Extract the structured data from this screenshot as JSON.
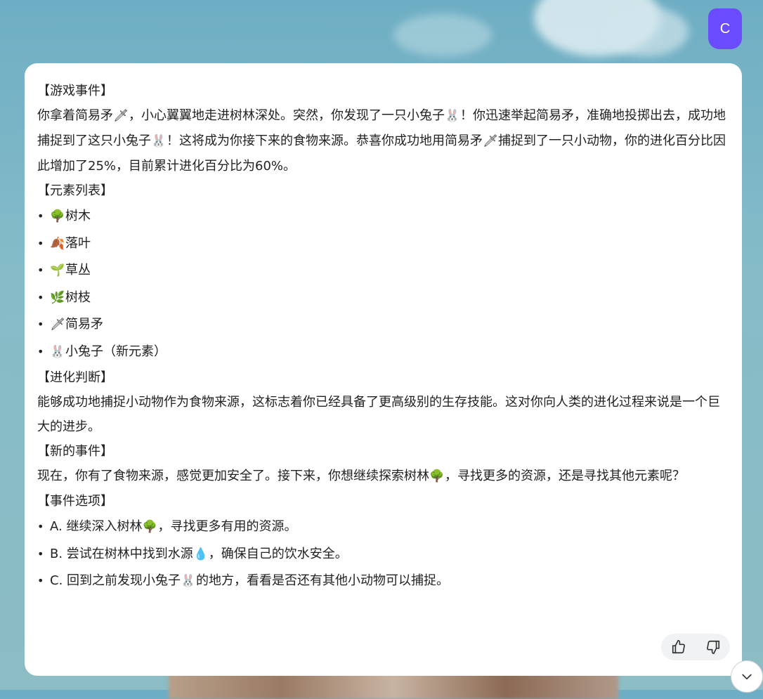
{
  "avatar": {
    "initial": "C"
  },
  "message": {
    "event_heading": "【游戏事件】",
    "event_text_parts": [
      "你拿着简易矛",
      "，小心翼翼地走进树林深处。突然，你发现了一只小兔子",
      "！你迅速举起简易矛，准确地投掷出去，成功地捕捉到了这只小兔子",
      "！这将成为你接下来的食物来源。恭喜你成功地用简易矛",
      "捕捉到了一只小动物，你的进化百分比因此增加了25%，目前累计进化百分比为60%。"
    ],
    "elements_heading": "【元素列表】",
    "elements": [
      {
        "icon": "tree-icon",
        "glyph": "🌳",
        "label": "树木"
      },
      {
        "icon": "fallen-leaf-icon",
        "glyph": "🍂",
        "label": "落叶"
      },
      {
        "icon": "seedling-icon",
        "glyph": "🌱",
        "label": "草丛"
      },
      {
        "icon": "herb-icon",
        "glyph": "🌿",
        "label": "树枝"
      },
      {
        "icon": "spear-icon",
        "glyph": "🗡",
        "label": "简易矛"
      },
      {
        "icon": "rabbit-icon",
        "glyph": "🐰",
        "label": "小兔子（新元素）"
      }
    ],
    "evolution_heading": "【进化判断】",
    "evolution_text": "能够成功地捕捉小动物作为食物来源，这标志着你已经具备了更高级别的生存技能。这对你向人类的进化过程来说是一个巨大的进步。",
    "new_event_heading": "【新的事件】",
    "new_event_parts": [
      "现在，你有了食物来源，感觉更加安全了。接下来，你想继续探索树林",
      "，寻找更多的资源，还是寻找其他元素呢？"
    ],
    "options_heading": "【事件选项】",
    "options": [
      {
        "before": "A. 继续深入树林",
        "icon": "tree-icon",
        "glyph": "🌳",
        "after": "，寻找更多有用的资源。"
      },
      {
        "before": "B. 尝试在树林中找到水源",
        "icon": "droplet-icon",
        "glyph": "💧",
        "after": "，确保自己的饮水安全。"
      },
      {
        "before": "C. 回到之前发现小兔子",
        "icon": "rabbit-icon",
        "glyph": "🐰",
        "after": "的地方，看看是否还有其他小动物可以捕捉。"
      }
    ],
    "inline_glyphs": {
      "spear": "🗡",
      "rabbit": "🐰",
      "tree": "🌳"
    }
  },
  "colors": {
    "avatar_bg": "#6b4bff",
    "card_bg": "#ffffff",
    "text": "#222222"
  }
}
